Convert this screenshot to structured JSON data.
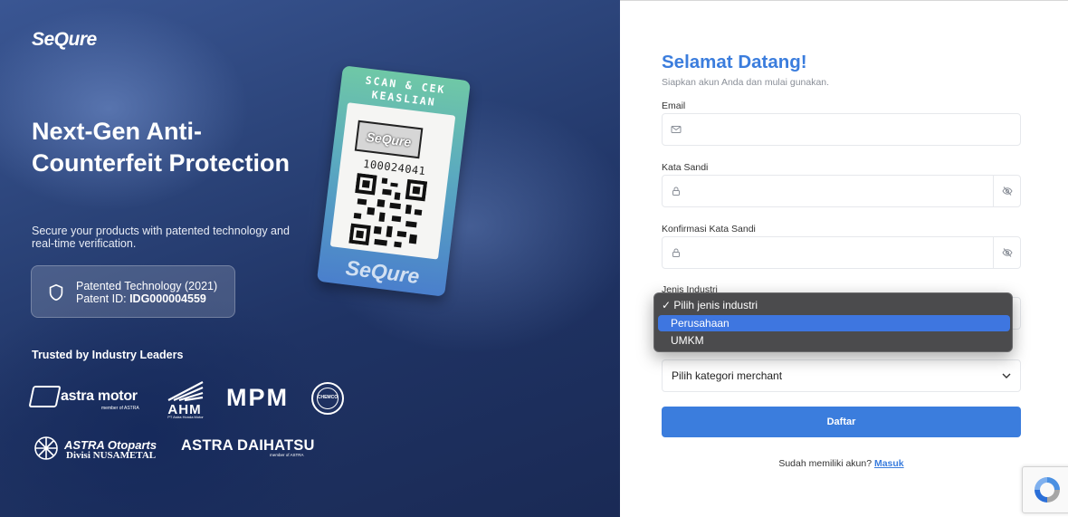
{
  "hero": {
    "brand": "SeQure",
    "headline": "Next-Gen Anti-Counterfeit Protection",
    "description": "Secure your products with patented technology and real-time verification.",
    "patent": {
      "line1": "Patented Technology (2021)",
      "id_label": "Patent ID:",
      "id_value": "IDG000004559"
    },
    "trusted_heading": "Trusted by Industry Leaders",
    "partners": {
      "astramotor": {
        "name": "astra motor",
        "sub": "member of ASTRA"
      },
      "ahm": {
        "name": "AHM",
        "sub": "PT Astra Honda Motor"
      },
      "mpm": {
        "name": "MPM"
      },
      "chemco": {
        "name": "CHEMCO"
      },
      "otoparts": {
        "name": "ASTRA Otoparts",
        "sub": "Divisi NUSAMETAL"
      },
      "daihatsu": {
        "name": "ASTRA DAIHATSU",
        "sub": "member of ASTRA"
      }
    },
    "tag": {
      "top": "SCAN & CEK KEASLIAN",
      "stamp": "SeQure",
      "number": "100024041",
      "brand": "SeQure"
    }
  },
  "form": {
    "title": "Selamat Datang!",
    "subtitle": "Siapkan akun Anda dan mulai gunakan.",
    "email_label": "Email",
    "password_label": "Kata Sandi",
    "confirm_label": "Konfirmasi Kata Sandi",
    "industry_label": "Jenis Industri",
    "category_select": "Pilih kategori merchant",
    "submit": "Daftar",
    "login_prompt": "Sudah memiliki akun?",
    "login_link": "Masuk"
  },
  "industry_dropdown": {
    "options": [
      {
        "label": "✓ Pilih jenis industri",
        "checked": true
      },
      {
        "label": "Perusahaan",
        "highlighted": true
      },
      {
        "label": "UMKM"
      }
    ]
  },
  "colors": {
    "accent": "#3b7ddd",
    "hero_dark": "#1f3364"
  }
}
